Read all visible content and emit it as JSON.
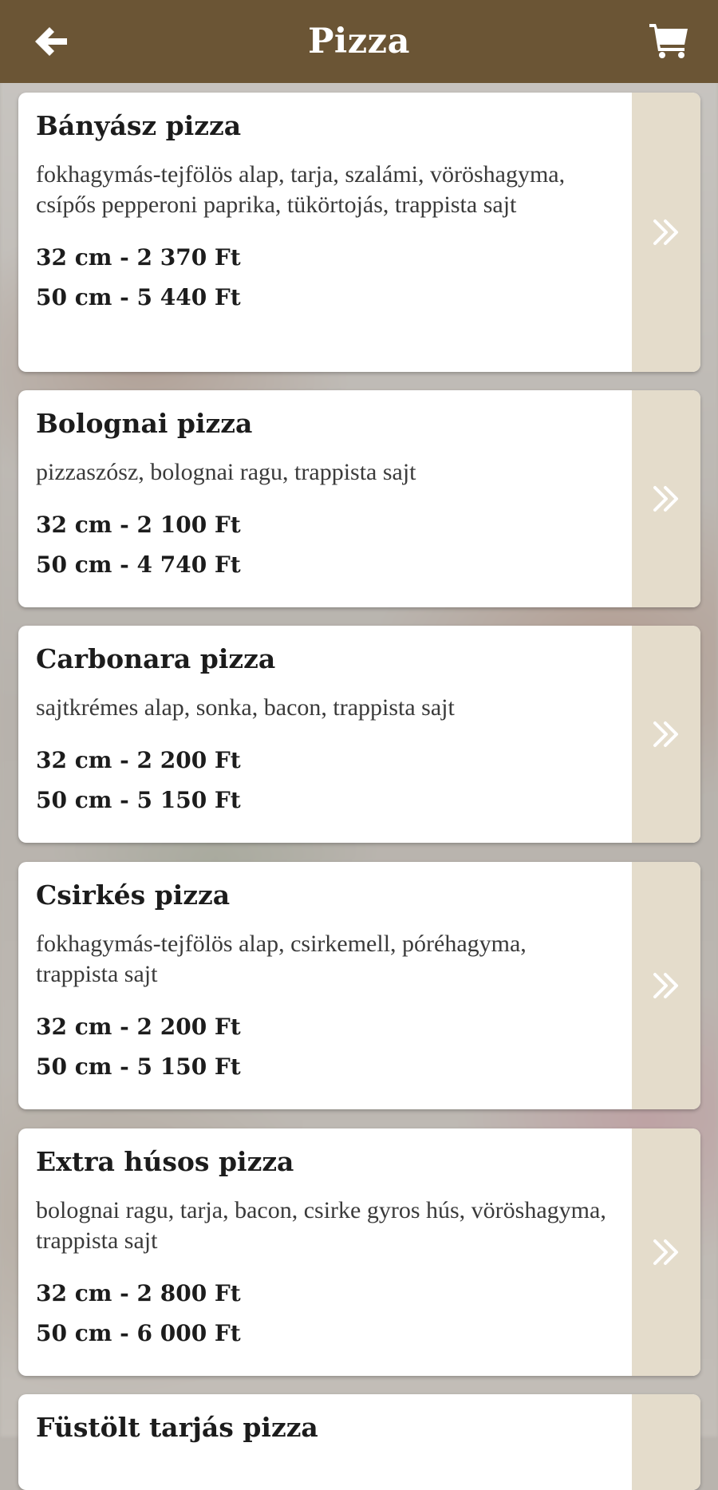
{
  "header": {
    "title": "Pizza",
    "back_icon": "arrow-left-icon",
    "cart_icon": "shopping-cart-icon",
    "bar_color": "#6b5535"
  },
  "colors": {
    "accent_panel": "#e4dccb",
    "card_bg": "#ffffff",
    "text": "#1c1c1c"
  },
  "items": [
    {
      "name": "Bányász pizza",
      "description": "fokhagymás-tejfölös alap, tarja, szalámi, vöröshagyma, csípős pepperoni paprika, tükörtojás, trappista sajt",
      "prices": [
        "32 cm - 2 370 Ft",
        "50 cm - 5 440 Ft"
      ]
    },
    {
      "name": "Bolognai pizza",
      "description": "pizzaszósz, bolognai ragu, trappista sajt",
      "prices": [
        "32 cm - 2 100 Ft",
        "50 cm - 4 740 Ft"
      ]
    },
    {
      "name": "Carbonara pizza",
      "description": "sajtkrémes alap, sonka, bacon, trappista sajt",
      "prices": [
        "32 cm - 2 200 Ft",
        "50 cm - 5 150 Ft"
      ]
    },
    {
      "name": "Csirkés pizza",
      "description": "fokhagymás-tejfölös alap, csirkemell, póréhagyma, trappista sajt",
      "prices": [
        "32 cm - 2 200 Ft",
        "50 cm - 5 150 Ft"
      ]
    },
    {
      "name": "Extra húsos pizza",
      "description": "bolognai ragu, tarja, bacon, csirke gyros hús, vöröshagyma, trappista sajt",
      "prices": [
        "32 cm - 2 800 Ft",
        "50 cm - 6 000 Ft"
      ]
    },
    {
      "name": "Füstölt tarjás pizza",
      "description": "",
      "prices": []
    }
  ]
}
